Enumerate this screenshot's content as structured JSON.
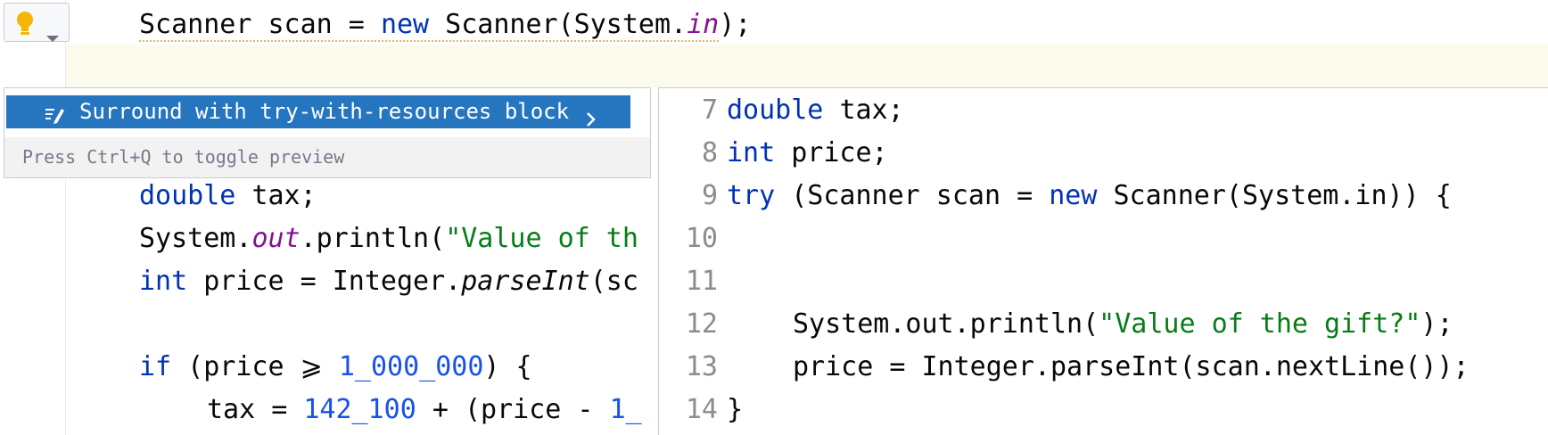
{
  "editor": {
    "line_scanner": [
      "Scanner scan = ",
      "new",
      " Scanner(System.",
      "in",
      ");"
    ],
    "line_double": [
      "double",
      " tax;"
    ],
    "line_print": [
      "System.",
      "out",
      ".println(",
      "\"Value of th"
    ],
    "line_int": [
      "int",
      " price = Integer.",
      "parseInt",
      "(sc"
    ],
    "line_if": [
      "if",
      " (price ⩾ ",
      "1_000_000",
      ") {"
    ],
    "line_tax": [
      "tax = ",
      "142_100",
      " + (price - ",
      "1_"
    ]
  },
  "intention": {
    "item_label": "Surround with try-with-resources block",
    "footer": "Press Ctrl+Q to toggle preview"
  },
  "preview": {
    "lines": [
      {
        "num": "7",
        "segs": [
          [
            "kw",
            "double"
          ],
          [
            "",
            "tax;"
          ]
        ]
      },
      {
        "num": "8",
        "segs": [
          [
            "kw",
            "int"
          ],
          [
            "",
            "price;"
          ]
        ]
      },
      {
        "num": "9",
        "segs": [
          [
            "kw",
            "try"
          ],
          [
            "",
            " (Scanner scan = "
          ],
          [
            "kw",
            "new"
          ],
          [
            "",
            " Scanner(System.in)) {"
          ]
        ]
      },
      {
        "num": "10",
        "segs": []
      },
      {
        "num": "11",
        "segs": []
      },
      {
        "num": "12",
        "segs": [
          [
            "",
            " System.out.println("
          ],
          [
            "str",
            "\"Value of the gift?\""
          ],
          [
            "",
            ");"
          ]
        ]
      },
      {
        "num": "13",
        "segs": [
          [
            "",
            " price = Integer.parseInt(scan.nextLine());"
          ]
        ]
      },
      {
        "num": "14",
        "segs": [
          [
            "",
            "}"
          ]
        ]
      }
    ]
  },
  "colors": {
    "keyword": "#0033b3",
    "number": "#1750eb",
    "string": "#067d17",
    "field": "#871094",
    "selection": "#2675bf",
    "caret_row": "#fcfaed"
  },
  "icons": [
    "lightbulb-icon",
    "chevron-down-icon",
    "edit-icon",
    "chevron-right-icon"
  ]
}
